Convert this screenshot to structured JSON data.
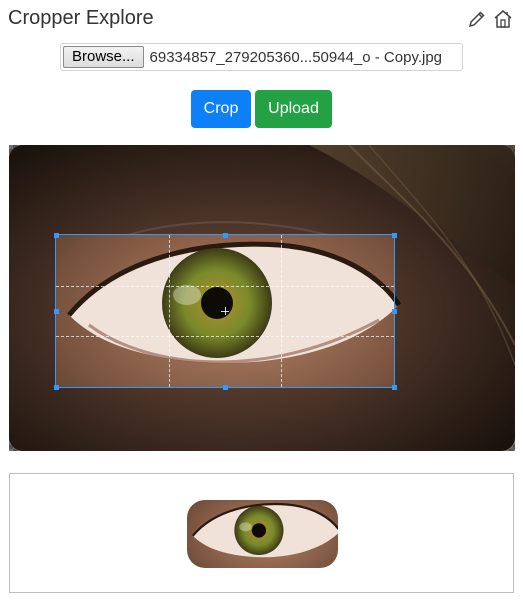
{
  "header": {
    "title": "Cropper Explore",
    "edit_icon": "pencil-icon",
    "home_icon": "house-icon"
  },
  "file_input": {
    "browse_label": "Browse...",
    "file_name": "69334857_279205360...50944_o - Copy.jpg"
  },
  "actions": {
    "crop_label": "Crop",
    "upload_label": "Upload"
  },
  "colors": {
    "crop_button": "#0d7ff7",
    "upload_button": "#22a244",
    "crop_box_outline": "#3399ff",
    "iris": "#7a8a2a"
  },
  "cropper": {
    "image_alt": "close-up photo of a green eye"
  }
}
